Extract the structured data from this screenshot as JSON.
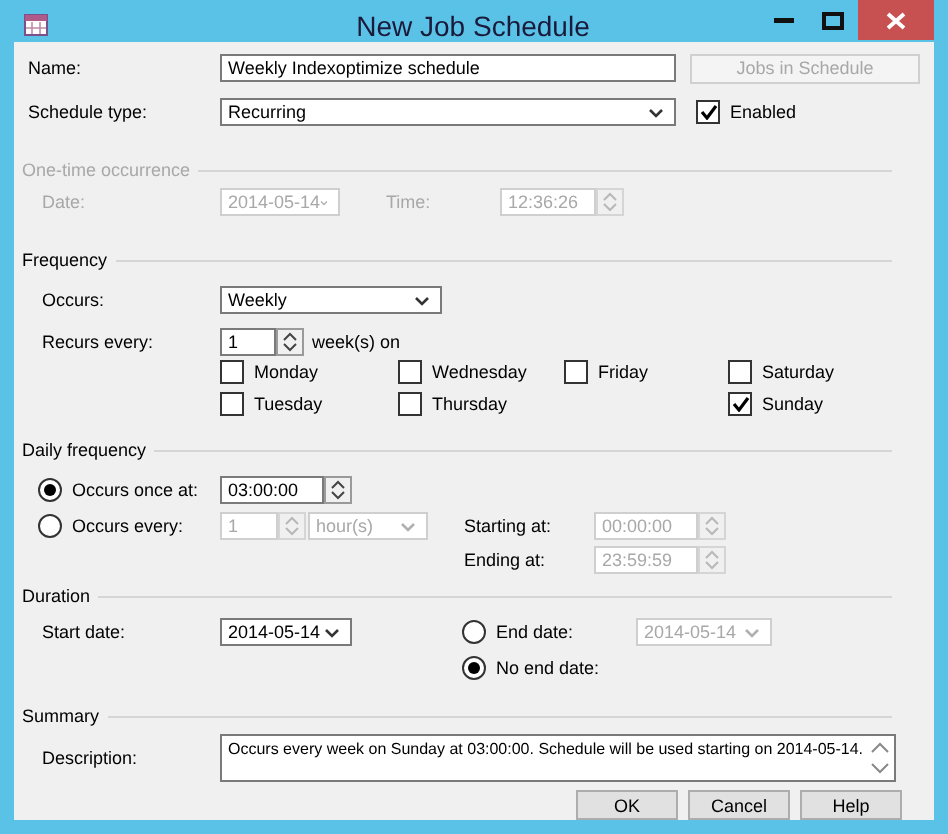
{
  "window": {
    "title": "New Job Schedule"
  },
  "name": {
    "label": "Name:",
    "value": "Weekly Indexoptimize schedule"
  },
  "jobs_button": {
    "label": "Jobs in Schedule",
    "disabled": true
  },
  "schedule_type": {
    "label": "Schedule type:",
    "value": "Recurring"
  },
  "enabled": {
    "label": "Enabled",
    "checked": true
  },
  "one_time": {
    "title": "One-time occurrence",
    "disabled": true,
    "date_label": "Date:",
    "date": "2014-05-14",
    "time_label": "Time:",
    "time": "12:36:26"
  },
  "frequency": {
    "title": "Frequency",
    "occurs_label": "Occurs:",
    "occurs": "Weekly",
    "recurs_label": "Recurs every:",
    "recurs_value": "1",
    "recurs_unit": "week(s) on",
    "day_rows": [
      [
        {
          "label": "Monday",
          "checked": false
        },
        {
          "label": "Wednesday",
          "checked": false
        },
        {
          "label": "Friday",
          "checked": false
        },
        {
          "label": "Saturday",
          "checked": false
        }
      ],
      [
        {
          "label": "Tuesday",
          "checked": false
        },
        {
          "label": "Thursday",
          "checked": false
        },
        {
          "label": "Sunday",
          "checked": true
        }
      ]
    ]
  },
  "daily": {
    "title": "Daily frequency",
    "options": [
      {
        "label": "Occurs once at:",
        "selected": true
      },
      {
        "label": "Occurs every:",
        "selected": false
      }
    ],
    "once_time": "03:00:00",
    "every_value": "1",
    "every_unit": "hour(s)",
    "starting_label": "Starting at:",
    "starting": "00:00:00",
    "ending_label": "Ending at:",
    "ending": "23:59:59"
  },
  "duration": {
    "title": "Duration",
    "start_label": "Start date:",
    "start": "2014-05-14",
    "end_options": [
      {
        "label": "End date:",
        "selected": false
      },
      {
        "label": "No end date:",
        "selected": true
      }
    ],
    "end_date": "2014-05-14"
  },
  "summary": {
    "title": "Summary",
    "description_label": "Description:",
    "description": "Occurs every week on Sunday at 03:00:00. Schedule will be used starting on 2014-05-14."
  },
  "buttons": [
    "OK",
    "Cancel",
    "Help"
  ]
}
